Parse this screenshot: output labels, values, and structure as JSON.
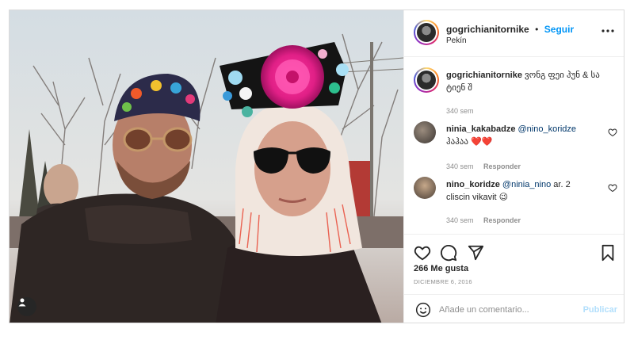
{
  "post": {
    "username": "gogrichianitornike",
    "follow_label": "Seguir",
    "separator": "•",
    "location": "Pekín",
    "caption": "ვონგ ფეი ჰუნ & სა ტიენ შ",
    "caption_time": "340 sem",
    "likes": "266 Me gusta",
    "date": "DICIEMBRE 6, 2016"
  },
  "comments": [
    {
      "username": "ninia_kakabadze",
      "mention": "@nino_koridze",
      "text_line2": "ჰაჰაა ❤️❤️",
      "time": "340 sem",
      "reply_label": "Responder"
    },
    {
      "username": "nino_koridze",
      "mention": "@ninia_nino",
      "text": "ar. 2",
      "text_line2": "cliscin vikavit 😉",
      "time": "340 sem",
      "reply_label": "Responder"
    }
  ],
  "comment_box": {
    "placeholder": "Añade un comentario...",
    "post_label": "Publicar"
  },
  "icons": {
    "more": "more-options-icon",
    "like": "heart-icon",
    "comment": "comment-icon",
    "share": "paper-plane-icon",
    "save": "bookmark-icon",
    "emoji": "emoji-icon",
    "tags": "user-tag-icon"
  },
  "colors": {
    "accent": "#0095f6",
    "text": "#262626",
    "muted": "#8e8e8e",
    "disabled_post": "#b2dffc"
  }
}
